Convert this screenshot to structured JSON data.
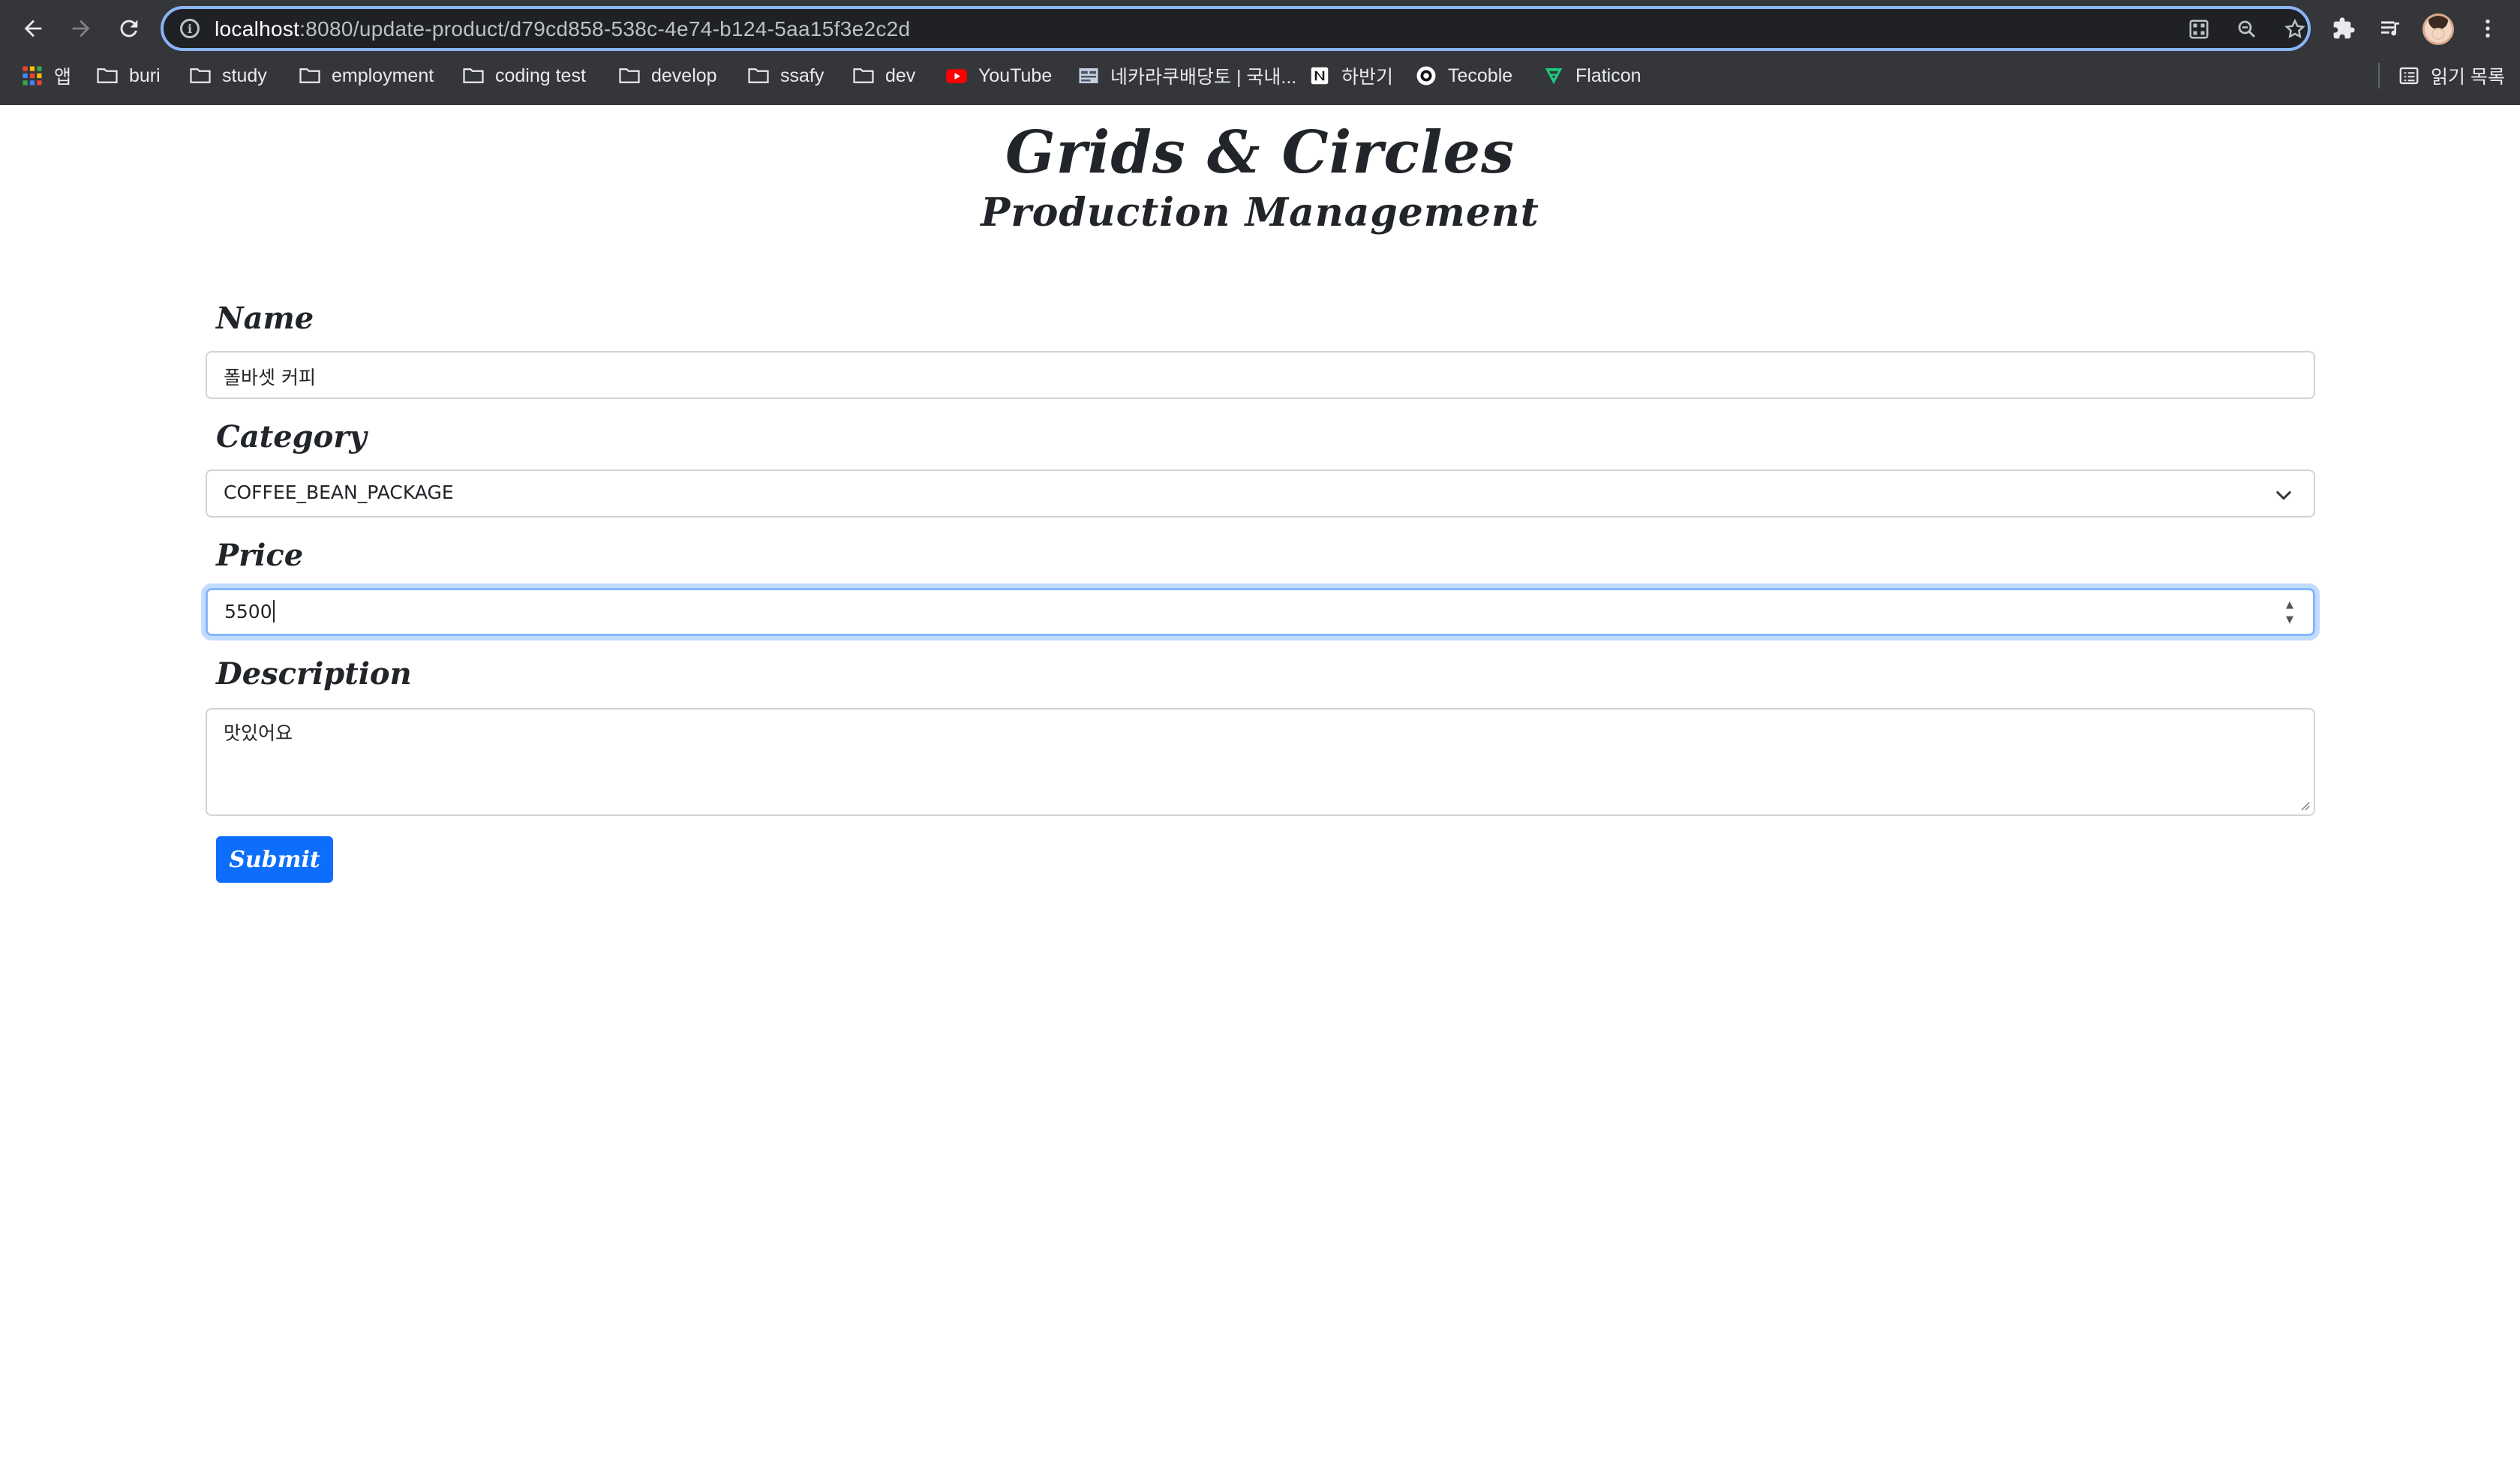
{
  "browser": {
    "url_host": "localhost",
    "url_rest": ":8080/update-product/d79cd858-538c-4e74-b124-5aa15f3e2c2d",
    "icons": {
      "back": "back-arrow-icon",
      "forward": "forward-arrow-icon",
      "reload": "reload-icon",
      "site_info": "info-icon",
      "qr": "qr-code-icon",
      "zoom": "zoom-icon",
      "star": "bookmark-star-icon",
      "extensions": "puzzle-icon",
      "media": "media-queue-icon",
      "menu": "kebab-menu-icon"
    },
    "bookmarks": [
      {
        "label": "앱",
        "icon": "apps-grid-icon"
      },
      {
        "label": "buri",
        "icon": "folder-icon"
      },
      {
        "label": "study",
        "icon": "folder-icon"
      },
      {
        "label": "employment",
        "icon": "folder-icon"
      },
      {
        "label": "coding test",
        "icon": "folder-icon"
      },
      {
        "label": "develop",
        "icon": "folder-icon"
      },
      {
        "label": "ssafy",
        "icon": "folder-icon"
      },
      {
        "label": "dev",
        "icon": "folder-icon"
      },
      {
        "label": "YouTube",
        "icon": "youtube-icon"
      },
      {
        "label": "네카라쿠배당토 | 국내...",
        "icon": "site-icon"
      },
      {
        "label": "하반기",
        "icon": "notion-icon"
      },
      {
        "label": "Tecoble",
        "icon": "tecoble-icon"
      },
      {
        "label": "Flaticon",
        "icon": "flaticon-icon"
      }
    ],
    "reading_list": "읽기 목록"
  },
  "page": {
    "title": "Grids & Circles",
    "subtitle": "Production Management",
    "form": {
      "name_label": "Name",
      "name_value": "폴바셋 커피",
      "category_label": "Category",
      "category_value": "COFFEE_BEAN_PACKAGE",
      "price_label": "Price",
      "price_value": "5500",
      "description_label": "Description",
      "description_value": "맛있어요",
      "submit_label": "Submit"
    }
  },
  "colors": {
    "chrome_bg": "#35363a",
    "omnibox_bg": "#202124",
    "focus_ring": "#8ab4f8",
    "primary": "#0d6efd",
    "text": "#212529"
  }
}
